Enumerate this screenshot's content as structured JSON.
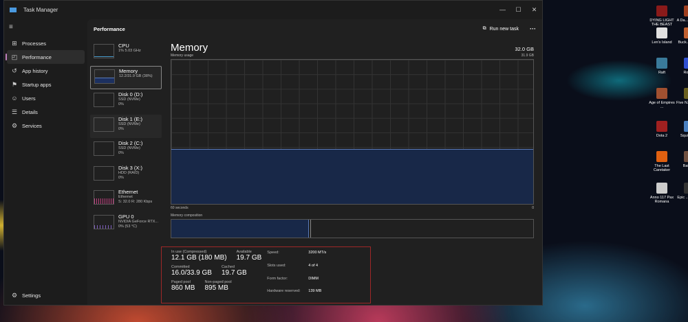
{
  "window": {
    "title": "Task Manager",
    "controls": [
      "—",
      "☐",
      "✕"
    ]
  },
  "sidebar": {
    "items": [
      {
        "label": "Processes",
        "icon": "processes-icon",
        "glyph": "⊞"
      },
      {
        "label": "Performance",
        "icon": "performance-icon",
        "glyph": "◰"
      },
      {
        "label": "App history",
        "icon": "app-history-icon",
        "glyph": "↺"
      },
      {
        "label": "Startup apps",
        "icon": "startup-icon",
        "glyph": "⚑"
      },
      {
        "label": "Users",
        "icon": "users-icon",
        "glyph": "☺"
      },
      {
        "label": "Details",
        "icon": "details-icon",
        "glyph": "☰"
      },
      {
        "label": "Services",
        "icon": "services-icon",
        "glyph": "⚙"
      }
    ],
    "settings": "Settings"
  },
  "header": {
    "title": "Performance",
    "run_new_task": "Run new task",
    "more": "···"
  },
  "devices": [
    {
      "name": "CPU",
      "line1": "1% 5.03 GHz",
      "line2": ""
    },
    {
      "name": "Memory",
      "line1": "12.2/31.9 GB (38%)",
      "line2": ""
    },
    {
      "name": "Disk 0 (D:)",
      "line1": "SSD (NVMe)",
      "line2": "0%"
    },
    {
      "name": "Disk 1 (E:)",
      "line1": "SSD (NVMe)",
      "line2": "0%"
    },
    {
      "name": "Disk 2 (C:)",
      "line1": "SSD (NVMe)",
      "line2": "0%"
    },
    {
      "name": "Disk 3 (X:)",
      "line1": "HDD (RAID)",
      "line2": "0%"
    },
    {
      "name": "Ethernet",
      "line1": "Ethernet",
      "line2": "S: 32.0 R: 280 Kbps"
    },
    {
      "name": "GPU 0",
      "line1": "NVIDIA GeForce RTX...",
      "line2": "0% (53 °C)"
    }
  ],
  "memory": {
    "title": "Memory",
    "total": "32.0 GB",
    "usage_label": "Memory usage",
    "usage_max": "31.9 GB",
    "time_left": "60 seconds",
    "time_right": "0",
    "composition_label": "Memory composition",
    "usage_fraction": 0.38
  },
  "stats": {
    "in_use_label": "In use (Compressed)",
    "in_use": "12.1 GB (180 MB)",
    "available_label": "Available",
    "available": "19.7 GB",
    "committed_label": "Committed",
    "committed": "16.0/33.9 GB",
    "cached_label": "Cached",
    "cached": "19.7 GB",
    "paged_label": "Paged pool",
    "paged": "860 MB",
    "nonpaged_label": "Non-paged pool",
    "nonpaged": "895 MB",
    "speed_label": "Speed:",
    "speed": "3200 MT/s",
    "slots_label": "Slots used:",
    "slots": "4 of 4",
    "form_label": "Form factor:",
    "form": "DIMM",
    "hwres_label": "Hardware reserved:",
    "hwres": "139 MB"
  },
  "desktop": [
    {
      "label": "DYING LIGHT THE BEAST",
      "color": "#8a1a1a"
    },
    {
      "label": "A Da... Fire a...",
      "color": "#a04020"
    },
    {
      "label": "Len's Island",
      "color": "#e0e0e0"
    },
    {
      "label": "Buck... Rou...",
      "color": "#c06030"
    },
    {
      "label": "Raft",
      "color": "#3a7a9a"
    },
    {
      "label": "Roblox",
      "color": "#3050d0"
    },
    {
      "label": "Age of Empires ...",
      "color": "#a05030"
    },
    {
      "label": "Five N... Fred...",
      "color": "#6a6020"
    },
    {
      "label": "Dota 2",
      "color": "#a02020"
    },
    {
      "label": "Squi... a ...",
      "color": "#4a80c0"
    },
    {
      "label": "The Last Caretaker",
      "color": "#e06010"
    },
    {
      "label": "Battle...",
      "color": "#705040"
    },
    {
      "label": "Anno 117 Pax Romana",
      "color": "#ccc"
    },
    {
      "label": "Epic ... Laun...",
      "color": "#333"
    }
  ]
}
